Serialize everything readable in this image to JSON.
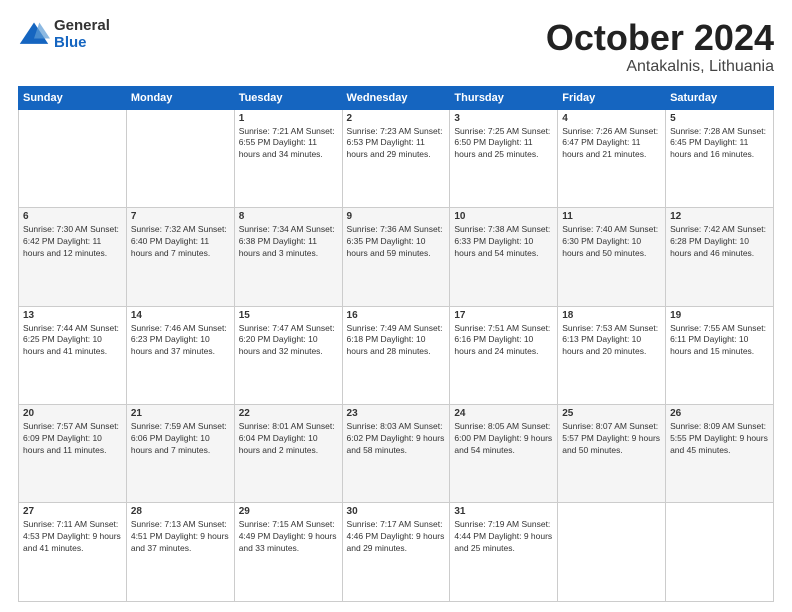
{
  "logo": {
    "general": "General",
    "blue": "Blue"
  },
  "header": {
    "month": "October 2024",
    "location": "Antakalnis, Lithuania"
  },
  "days_of_week": [
    "Sunday",
    "Monday",
    "Tuesday",
    "Wednesday",
    "Thursday",
    "Friday",
    "Saturday"
  ],
  "weeks": [
    [
      {
        "day": "",
        "info": ""
      },
      {
        "day": "",
        "info": ""
      },
      {
        "day": "1",
        "info": "Sunrise: 7:21 AM\nSunset: 6:55 PM\nDaylight: 11 hours\nand 34 minutes."
      },
      {
        "day": "2",
        "info": "Sunrise: 7:23 AM\nSunset: 6:53 PM\nDaylight: 11 hours\nand 29 minutes."
      },
      {
        "day": "3",
        "info": "Sunrise: 7:25 AM\nSunset: 6:50 PM\nDaylight: 11 hours\nand 25 minutes."
      },
      {
        "day": "4",
        "info": "Sunrise: 7:26 AM\nSunset: 6:47 PM\nDaylight: 11 hours\nand 21 minutes."
      },
      {
        "day": "5",
        "info": "Sunrise: 7:28 AM\nSunset: 6:45 PM\nDaylight: 11 hours\nand 16 minutes."
      }
    ],
    [
      {
        "day": "6",
        "info": "Sunrise: 7:30 AM\nSunset: 6:42 PM\nDaylight: 11 hours\nand 12 minutes."
      },
      {
        "day": "7",
        "info": "Sunrise: 7:32 AM\nSunset: 6:40 PM\nDaylight: 11 hours\nand 7 minutes."
      },
      {
        "day": "8",
        "info": "Sunrise: 7:34 AM\nSunset: 6:38 PM\nDaylight: 11 hours\nand 3 minutes."
      },
      {
        "day": "9",
        "info": "Sunrise: 7:36 AM\nSunset: 6:35 PM\nDaylight: 10 hours\nand 59 minutes."
      },
      {
        "day": "10",
        "info": "Sunrise: 7:38 AM\nSunset: 6:33 PM\nDaylight: 10 hours\nand 54 minutes."
      },
      {
        "day": "11",
        "info": "Sunrise: 7:40 AM\nSunset: 6:30 PM\nDaylight: 10 hours\nand 50 minutes."
      },
      {
        "day": "12",
        "info": "Sunrise: 7:42 AM\nSunset: 6:28 PM\nDaylight: 10 hours\nand 46 minutes."
      }
    ],
    [
      {
        "day": "13",
        "info": "Sunrise: 7:44 AM\nSunset: 6:25 PM\nDaylight: 10 hours\nand 41 minutes."
      },
      {
        "day": "14",
        "info": "Sunrise: 7:46 AM\nSunset: 6:23 PM\nDaylight: 10 hours\nand 37 minutes."
      },
      {
        "day": "15",
        "info": "Sunrise: 7:47 AM\nSunset: 6:20 PM\nDaylight: 10 hours\nand 32 minutes."
      },
      {
        "day": "16",
        "info": "Sunrise: 7:49 AM\nSunset: 6:18 PM\nDaylight: 10 hours\nand 28 minutes."
      },
      {
        "day": "17",
        "info": "Sunrise: 7:51 AM\nSunset: 6:16 PM\nDaylight: 10 hours\nand 24 minutes."
      },
      {
        "day": "18",
        "info": "Sunrise: 7:53 AM\nSunset: 6:13 PM\nDaylight: 10 hours\nand 20 minutes."
      },
      {
        "day": "19",
        "info": "Sunrise: 7:55 AM\nSunset: 6:11 PM\nDaylight: 10 hours\nand 15 minutes."
      }
    ],
    [
      {
        "day": "20",
        "info": "Sunrise: 7:57 AM\nSunset: 6:09 PM\nDaylight: 10 hours\nand 11 minutes."
      },
      {
        "day": "21",
        "info": "Sunrise: 7:59 AM\nSunset: 6:06 PM\nDaylight: 10 hours\nand 7 minutes."
      },
      {
        "day": "22",
        "info": "Sunrise: 8:01 AM\nSunset: 6:04 PM\nDaylight: 10 hours\nand 2 minutes."
      },
      {
        "day": "23",
        "info": "Sunrise: 8:03 AM\nSunset: 6:02 PM\nDaylight: 9 hours\nand 58 minutes."
      },
      {
        "day": "24",
        "info": "Sunrise: 8:05 AM\nSunset: 6:00 PM\nDaylight: 9 hours\nand 54 minutes."
      },
      {
        "day": "25",
        "info": "Sunrise: 8:07 AM\nSunset: 5:57 PM\nDaylight: 9 hours\nand 50 minutes."
      },
      {
        "day": "26",
        "info": "Sunrise: 8:09 AM\nSunset: 5:55 PM\nDaylight: 9 hours\nand 45 minutes."
      }
    ],
    [
      {
        "day": "27",
        "info": "Sunrise: 7:11 AM\nSunset: 4:53 PM\nDaylight: 9 hours\nand 41 minutes."
      },
      {
        "day": "28",
        "info": "Sunrise: 7:13 AM\nSunset: 4:51 PM\nDaylight: 9 hours\nand 37 minutes."
      },
      {
        "day": "29",
        "info": "Sunrise: 7:15 AM\nSunset: 4:49 PM\nDaylight: 9 hours\nand 33 minutes."
      },
      {
        "day": "30",
        "info": "Sunrise: 7:17 AM\nSunset: 4:46 PM\nDaylight: 9 hours\nand 29 minutes."
      },
      {
        "day": "31",
        "info": "Sunrise: 7:19 AM\nSunset: 4:44 PM\nDaylight: 9 hours\nand 25 minutes."
      },
      {
        "day": "",
        "info": ""
      },
      {
        "day": "",
        "info": ""
      }
    ]
  ]
}
